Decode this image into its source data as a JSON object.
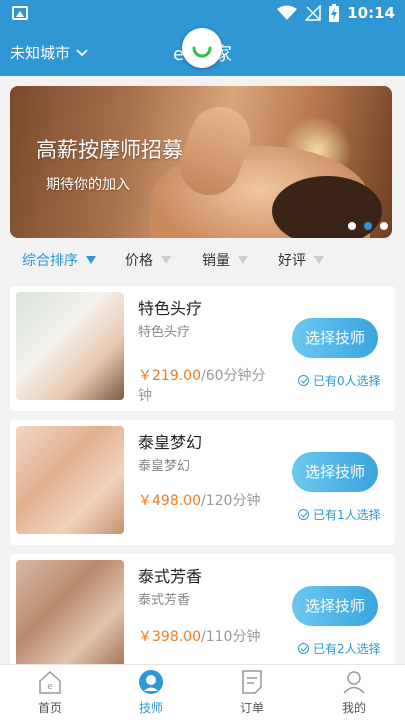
{
  "status": {
    "time": "10:14"
  },
  "header": {
    "city": "未知城市",
    "title_left": "e",
    "title_right": "家"
  },
  "banner": {
    "title": "高薪按摩师招募",
    "subtitle": "期待你的加入"
  },
  "sort": [
    {
      "label": "综合排序",
      "active": true
    },
    {
      "label": "价格"
    },
    {
      "label": "销量"
    },
    {
      "label": "好评"
    }
  ],
  "items": [
    {
      "name": "特色头疗",
      "desc": "特色头疗",
      "price": "￥219.00",
      "unit": "/60分钟分钟",
      "button": "选择技师",
      "chosen": "已有0人选择"
    },
    {
      "name": "泰皇梦幻",
      "desc": "泰皇梦幻",
      "price": "￥498.00",
      "unit": "/120分钟",
      "button": "选择技师",
      "chosen": "已有1人选择"
    },
    {
      "name": "泰式芳香",
      "desc": "泰式芳香",
      "price": "￥398.00",
      "unit": "/110分钟",
      "button": "选择技师",
      "chosen": "已有2人选择"
    }
  ],
  "tabs": [
    {
      "label": "首页",
      "icon": "home-icon"
    },
    {
      "label": "技师",
      "icon": "technician-icon",
      "active": true
    },
    {
      "label": "订单",
      "icon": "order-icon"
    },
    {
      "label": "我的",
      "icon": "profile-icon"
    }
  ],
  "colors": {
    "primary": "#2f97d4",
    "price": "#f07a1c"
  }
}
